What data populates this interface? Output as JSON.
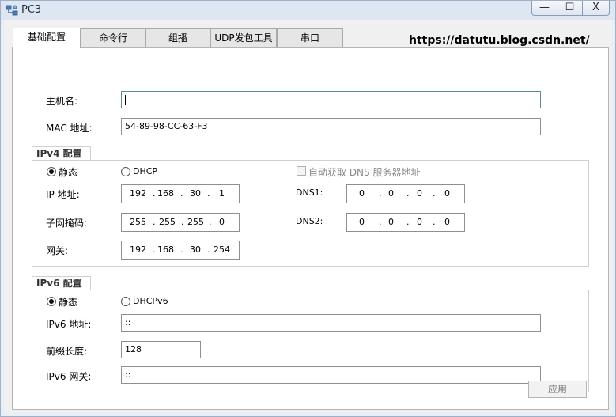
{
  "window": {
    "title": "PC3",
    "minimize": "—",
    "maximize": "☐",
    "close": "X",
    "icon": "pc-network-icon"
  },
  "tabs": [
    {
      "label": "基础配置",
      "active": true
    },
    {
      "label": "命令行"
    },
    {
      "label": "组播"
    },
    {
      "label": "UDP发包工具"
    },
    {
      "label": "串口"
    }
  ],
  "watermark": "https://datutu.blog.csdn.net/",
  "basic": {
    "hostname_label": "主机名:",
    "hostname_value": "",
    "mac_label": "MAC 地址:",
    "mac_value": "54-89-98-CC-63-F3"
  },
  "ipv4": {
    "group_title": "IPv4 配置",
    "static_label": "静态",
    "dhcp_label": "DHCP",
    "auto_dns_label": "自动获取 DNS 服务器地址",
    "ip_label": "IP 地址:",
    "ip": [
      "192",
      "168",
      "30",
      "1"
    ],
    "mask_label": "子网掩码:",
    "mask": [
      "255",
      "255",
      "255",
      "0"
    ],
    "gateway_label": "网关:",
    "gateway": [
      "192",
      "168",
      "30",
      "254"
    ],
    "dns1_label": "DNS1:",
    "dns1": [
      "0",
      "0",
      "0",
      "0"
    ],
    "dns2_label": "DNS2:",
    "dns2": [
      "0",
      "0",
      "0",
      "0"
    ]
  },
  "ipv6": {
    "group_title": "IPv6 配置",
    "static_label": "静态",
    "dhcp_label": "DHCPv6",
    "addr_label": "IPv6 地址:",
    "addr_value": "::",
    "prefix_label": "前缀长度:",
    "prefix_value": "128",
    "gateway_label": "IPv6 网关:",
    "gateway_value": "::"
  },
  "apply_label": "应用"
}
